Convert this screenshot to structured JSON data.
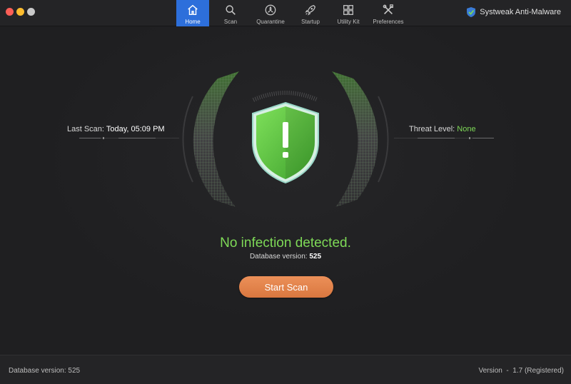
{
  "nav": {
    "items": [
      {
        "label": "Home",
        "icon": "home-icon",
        "active": true
      },
      {
        "label": "Scan",
        "icon": "search-icon"
      },
      {
        "label": "Quarantine",
        "icon": "biohazard-icon"
      },
      {
        "label": "Startup",
        "icon": "rocket-icon"
      },
      {
        "label": "Utility Kit",
        "icon": "grid-icon"
      },
      {
        "label": "Preferences",
        "icon": "tools-icon"
      }
    ]
  },
  "brand": {
    "name": "Systweak Anti-Malware"
  },
  "dashboard": {
    "last_scan_label": "Last Scan:",
    "last_scan_value": "Today, 05:09 PM",
    "threat_label": "Threat Level:",
    "threat_value": "None",
    "status": "No infection detected.",
    "db_label": "Database version:",
    "db_value": "525",
    "start_scan": "Start Scan"
  },
  "footer": {
    "database": "Database version: 525",
    "version": "Version  -  1.7 (Registered)"
  },
  "colors": {
    "accent": "#2d6fdb",
    "ok": "#7ed957",
    "button": "#e38650"
  }
}
